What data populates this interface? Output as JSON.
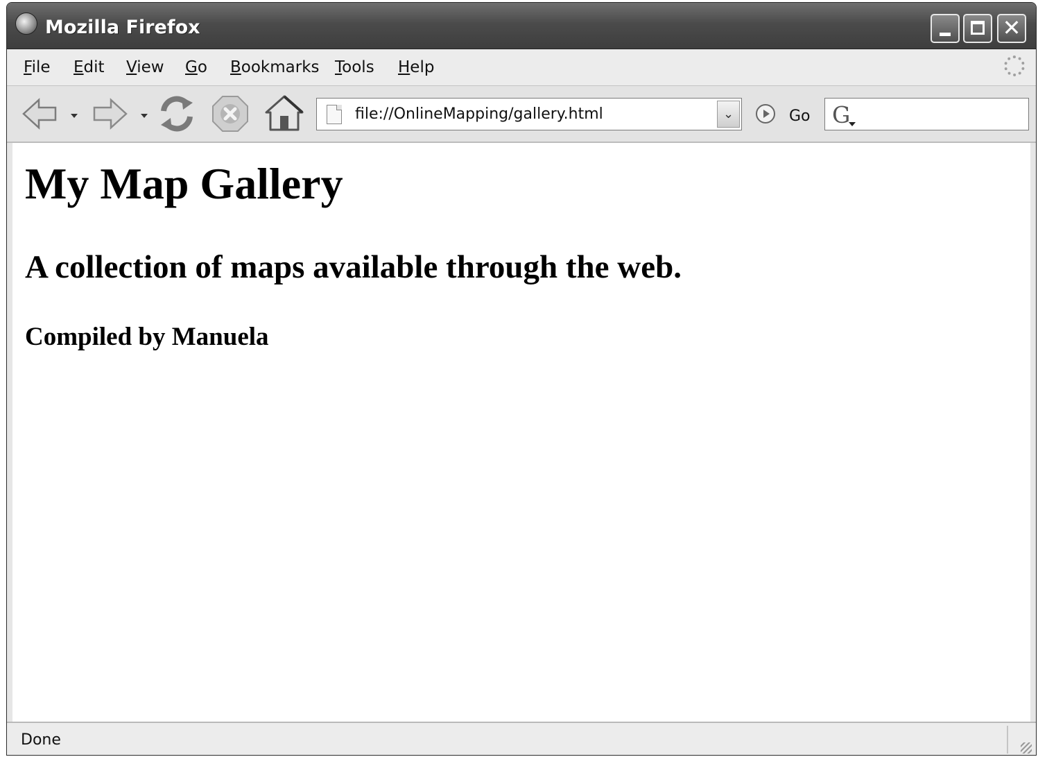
{
  "window": {
    "title": "Mozilla Firefox",
    "controls": {
      "minimize": "minimize",
      "maximize": "maximize",
      "close": "✕"
    }
  },
  "menubar": {
    "items": [
      {
        "label": "File"
      },
      {
        "label": "Edit"
      },
      {
        "label": "View"
      },
      {
        "label": "Go"
      },
      {
        "label": "Bookmarks"
      },
      {
        "label": "Tools"
      },
      {
        "label": "Help"
      }
    ]
  },
  "navbar": {
    "icons": [
      "back-arrow-icon",
      "forward-arrow-icon",
      "reload-icon",
      "stop-icon",
      "home-icon"
    ],
    "url": "file://OnlineMapping/gallery.html",
    "go_label": "Go",
    "search_engine_letter": "G"
  },
  "page": {
    "heading": "My Map Gallery",
    "subheading": "A collection of maps available through the web.",
    "byline": "Compiled by Manuela"
  },
  "statusbar": {
    "text": "Done"
  }
}
